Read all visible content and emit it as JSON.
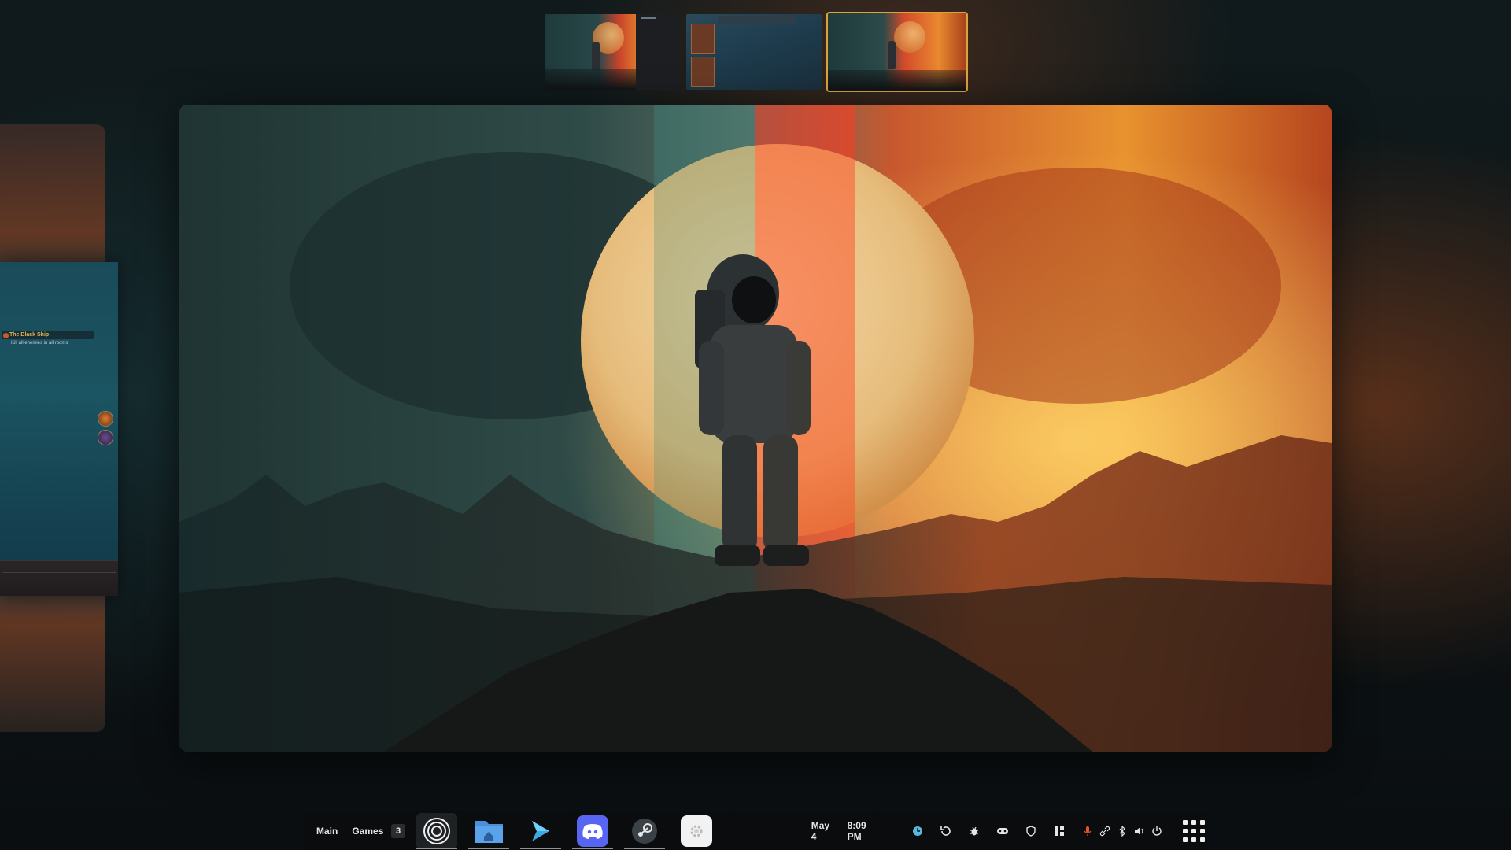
{
  "workspaces_overview": {
    "thumbnails": [
      {
        "name": "workspace-1",
        "active": false
      },
      {
        "name": "workspace-2",
        "active": false
      },
      {
        "name": "workspace-3",
        "active": true
      }
    ]
  },
  "left_window": {
    "quest_title": "The Black Ship",
    "quest_subtitle": "Kill all enemies in all rooms"
  },
  "taskbar": {
    "workspace_main": "Main",
    "workspace_games": "Games",
    "workspace_count": "3",
    "apps": [
      {
        "name": "cider-app",
        "icon": "concentric-circles-icon"
      },
      {
        "name": "file-manager-app",
        "icon": "folder-home-icon"
      },
      {
        "name": "vscode-app",
        "icon": "chevron-arrow-icon"
      },
      {
        "name": "discord-app",
        "icon": "discord-icon"
      },
      {
        "name": "steam-app",
        "icon": "steam-icon"
      },
      {
        "name": "settings-app",
        "icon": "gear-icon"
      }
    ],
    "date": "May 4",
    "time": "8:09 PM",
    "tray": [
      "clock-app-icon",
      "refresh-icon",
      "bug-icon",
      "gamepad-icon",
      "shield-icon",
      "layout-icon",
      "microphone-icon",
      "link-icon",
      "bluetooth-icon",
      "volume-icon",
      "power-icon",
      "apps-grid-icon"
    ]
  },
  "colors": {
    "active_workspace_border": "#d9a43b",
    "taskbar_bg": "#0a0c0d",
    "discord": "#5865f2",
    "folder": "#4a8fdc",
    "vscode": "#3fa9e0",
    "mic_active": "#e2542c"
  }
}
